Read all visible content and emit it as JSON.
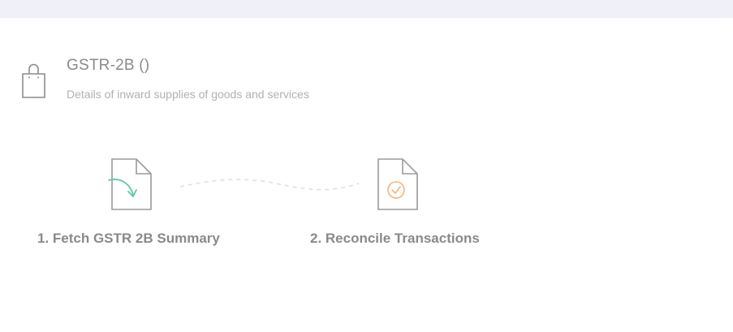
{
  "header": {
    "title": "GSTR-2B ()",
    "subtitle": "Details of inward supplies of goods and services",
    "icon": "shopping-bag-icon"
  },
  "steps": [
    {
      "label": "1. Fetch GSTR 2B Summary",
      "icon": "document-fetch-icon",
      "accent_color": "#5cc9a7"
    },
    {
      "label": "2. Reconcile Transactions",
      "icon": "document-check-icon",
      "accent_color": "#f5b37a"
    }
  ],
  "colors": {
    "top_bar": "#f0f0f8",
    "text": "#8a8a8a",
    "muted_text": "#b0b0b8",
    "icon_stroke": "#8c8c8c"
  }
}
